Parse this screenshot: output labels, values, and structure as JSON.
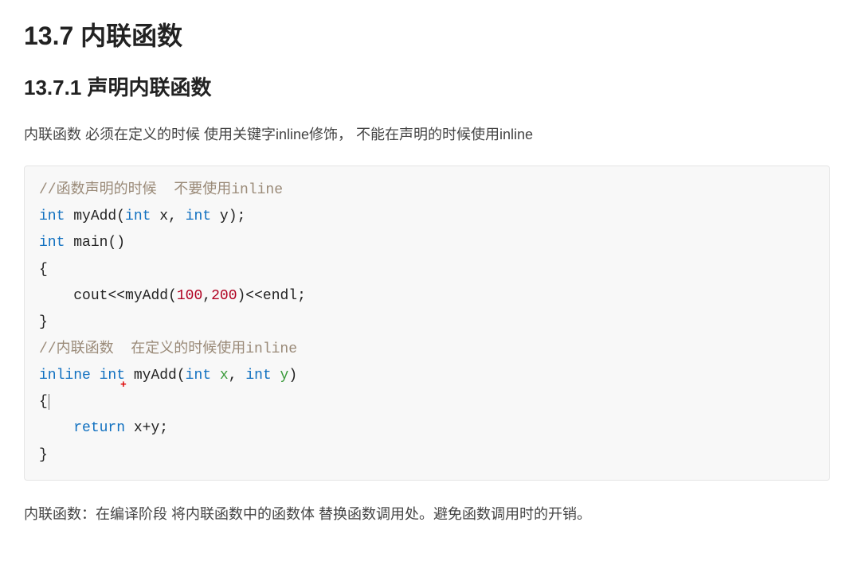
{
  "heading1": "13.7 内联函数",
  "heading2": "13.7.1 声明内联函数",
  "intro_para": "内联函数  必须在定义的时候 使用关键字inline修饰，  不能在声明的时候使用inline",
  "outro_para": "内联函数：在编译阶段 将内联函数中的函数体 替换函数调用处。避免函数调用时的开销。",
  "code": {
    "comment1_prefix": "//函数声明的时候  不要使用",
    "comment1_kw": "inline",
    "decl_kw_int_1": "int",
    "decl_fn_myAdd": "myAdd",
    "decl_kw_int_2": "int",
    "decl_param_x": "x",
    "decl_kw_int_3": "int",
    "decl_param_y": "y",
    "main_kw_int": "int",
    "main_fn": "main",
    "cout_id": "cout",
    "call_fn": "myAdd",
    "num_100": "100",
    "num_200": "200",
    "endl_id": "endl",
    "comment2_prefix": "//内联函数  在定义的时候使用",
    "comment2_kw": "inline",
    "inline_kw": "inline",
    "def_kw_int_1": "int",
    "def_fn_myAdd": "myAdd",
    "def_kw_int_2": "int",
    "def_param_x": "x",
    "def_kw_int_3": "int",
    "def_param_y": "y",
    "return_kw": "return",
    "ret_x": "x",
    "ret_y": "y",
    "plus_marker": "+"
  }
}
